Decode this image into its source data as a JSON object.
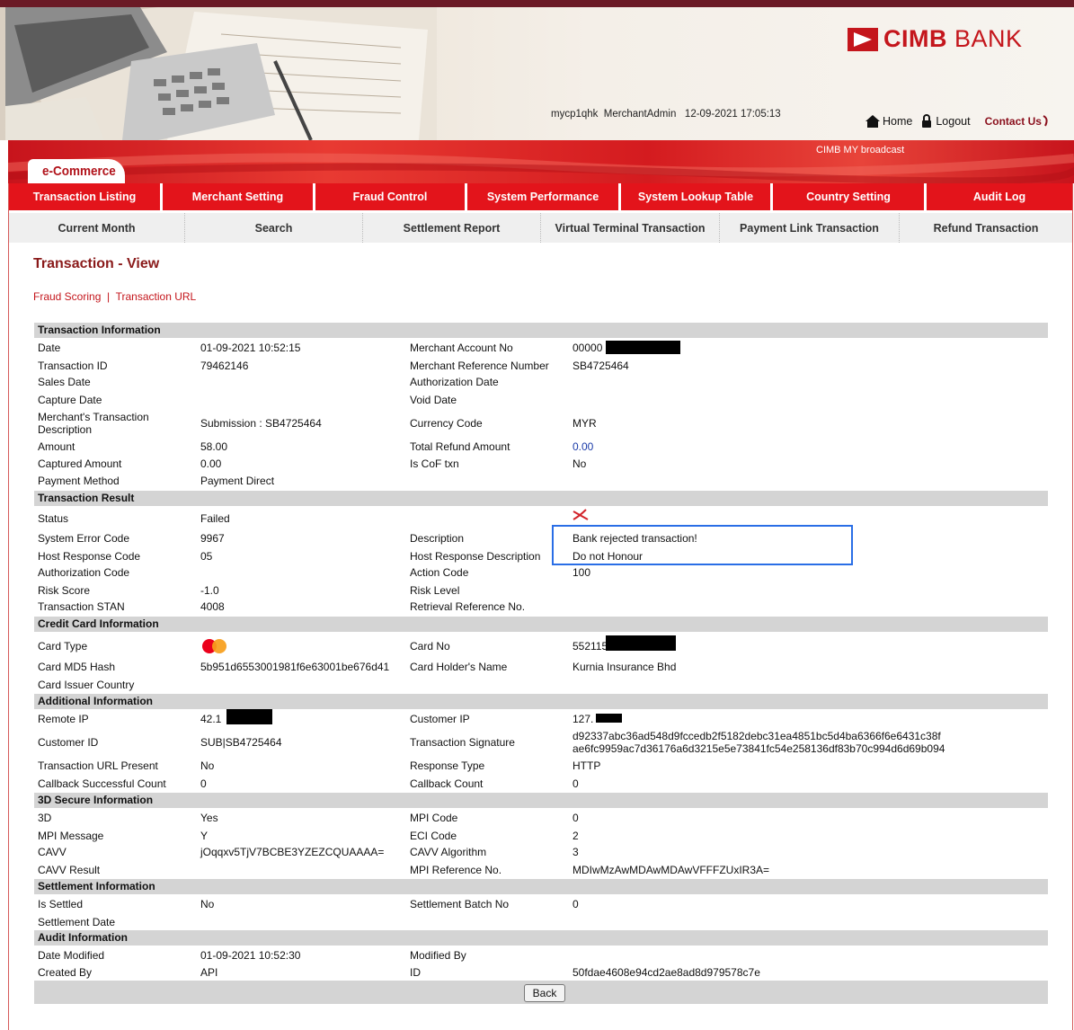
{
  "brand": {
    "name_bold": "CIMB",
    "name_light": "BANK"
  },
  "header": {
    "user_info": "mycp1qhk  MerchantAdmin   12-09-2021 17:05:13",
    "home_label": "Home",
    "logout_label": "Logout",
    "contact_label": "Contact Us",
    "broadcast": "CIMB MY broadcast",
    "ecommerce_tab": "e-Commerce"
  },
  "main_nav": [
    "Transaction Listing",
    "Merchant Setting",
    "Fraud Control",
    "System Performance",
    "System Lookup Table",
    "Country Setting",
    "Audit Log"
  ],
  "sub_nav": [
    "Current Month",
    "Search",
    "Settlement Report",
    "Virtual Terminal Transaction",
    "Payment Link Transaction",
    "Refund Transaction"
  ],
  "page": {
    "title": "Transaction - View",
    "links": [
      "Fraud Scoring",
      "Transaction URL"
    ],
    "link_separator": "|"
  },
  "sections": {
    "transaction_info": "Transaction Information",
    "transaction_result": "Transaction Result",
    "credit_card": "Credit Card Information",
    "additional": "Additional Information",
    "secure3d": "3D Secure Information",
    "settlement": "Settlement Information",
    "audit": "Audit Information"
  },
  "fields": {
    "date_l": "Date",
    "date_v": "01-09-2021 10:52:15",
    "merchant_account_l": "Merchant Account No",
    "merchant_account_v": "00000",
    "transaction_id_l": "Transaction ID",
    "transaction_id_v": "79462146",
    "merchant_ref_l": "Merchant Reference Number",
    "merchant_ref_v": "SB4725464",
    "sales_date_l": "Sales Date",
    "auth_date_l": "Authorization Date",
    "capture_date_l": "Capture Date",
    "void_date_l": "Void Date",
    "merchant_desc_l1": "Merchant's Transaction",
    "merchant_desc_l2": "Description",
    "merchant_desc_v": "Submission : SB4725464",
    "currency_l": "Currency Code",
    "currency_v": "MYR",
    "amount_l": "Amount",
    "amount_v": "58.00",
    "refund_l": "Total Refund Amount",
    "refund_v": "0.00",
    "captured_l": "Captured Amount",
    "captured_v": "0.00",
    "cof_l": "Is CoF txn",
    "cof_v": "No",
    "payment_method_l": "Payment Method",
    "payment_method_v": "Payment Direct",
    "status_l": "Status",
    "status_v": "Failed",
    "sys_error_l": "System Error Code",
    "sys_error_v": "9967",
    "description_l": "Description",
    "description_v": "Bank rejected transaction!",
    "host_resp_code_l": "Host Response Code",
    "host_resp_code_v": "05",
    "host_resp_desc_l": "Host Response Description",
    "host_resp_desc_v": "Do not Honour",
    "auth_code_l": "Authorization Code",
    "action_code_l": "Action Code",
    "action_code_v": "100",
    "risk_score_l": "Risk Score",
    "risk_score_v": "-1.0",
    "risk_level_l": "Risk Level",
    "stan_l": "Transaction STAN",
    "stan_v": "4008",
    "rrn_l": "Retrieval Reference No.",
    "card_type_l": "Card Type",
    "card_no_l": "Card No",
    "card_no_v": "552115",
    "card_md5_l": "Card MD5 Hash",
    "card_md5_v": "5b951d6553001981f6e63001be676d41",
    "holder_l": "Card Holder's Name",
    "holder_v": "Kurnia Insurance Bhd",
    "issuer_country_l": "Card Issuer Country",
    "remote_ip_l": "Remote IP",
    "remote_ip_v": "42.1",
    "customer_ip_l": "Customer IP",
    "customer_ip_v": "127.",
    "customer_id_l": "Customer ID",
    "customer_id_v": "SUB|SB4725464",
    "signature_l": "Transaction Signature",
    "signature_v1": "d92337abc36ad548d9fccedb2f5182debc31ea4851bc5d4ba6366f6e6431c38f",
    "signature_v2": "ae6fc9959ac7d36176a6d3215e5e73841fc54e258136df83b70c994d6d69b094",
    "url_present_l": "Transaction URL Present",
    "url_present_v": "No",
    "response_type_l": "Response Type",
    "response_type_v": "HTTP",
    "callback_success_l": "Callback Successful Count",
    "callback_success_v": "0",
    "callback_count_l": "Callback Count",
    "callback_count_v": "0",
    "d3_l": "3D",
    "d3_v": "Yes",
    "mpi_code_l": "MPI Code",
    "mpi_code_v": "0",
    "mpi_msg_l": "MPI Message",
    "mpi_msg_v": "Y",
    "eci_l": "ECI Code",
    "eci_v": "2",
    "cavv_l": "CAVV",
    "cavv_v": "jOqqxv5TjV7BCBE3YZEZCQUAAAA=",
    "cavv_algo_l": "CAVV Algorithm",
    "cavv_algo_v": "3",
    "cavv_result_l": "CAVV Result",
    "mpi_ref_l": "MPI Reference No.",
    "mpi_ref_v": "MDIwMzAwMDAwMDAwVFFFZUxIR3A=",
    "is_settled_l": "Is Settled",
    "is_settled_v": "No",
    "batch_l": "Settlement Batch No",
    "batch_v": "0",
    "settle_date_l": "Settlement Date",
    "date_modified_l": "Date Modified",
    "date_modified_v": "01-09-2021 10:52:30",
    "modified_by_l": "Modified By",
    "created_by_l": "Created By",
    "created_by_v": "API",
    "id_l": "ID",
    "id_v": "50fdae4608e94cd2ae8ad8d979578c7e"
  },
  "back_button": "Back",
  "colors": {
    "brand_red": "#c4161c",
    "nav_red": "#e3141b",
    "maroon": "#6b1a26",
    "section_gray": "#d4d4d4",
    "highlight_blue": "#2a6ee6",
    "link_blue": "#1a3aa8"
  }
}
